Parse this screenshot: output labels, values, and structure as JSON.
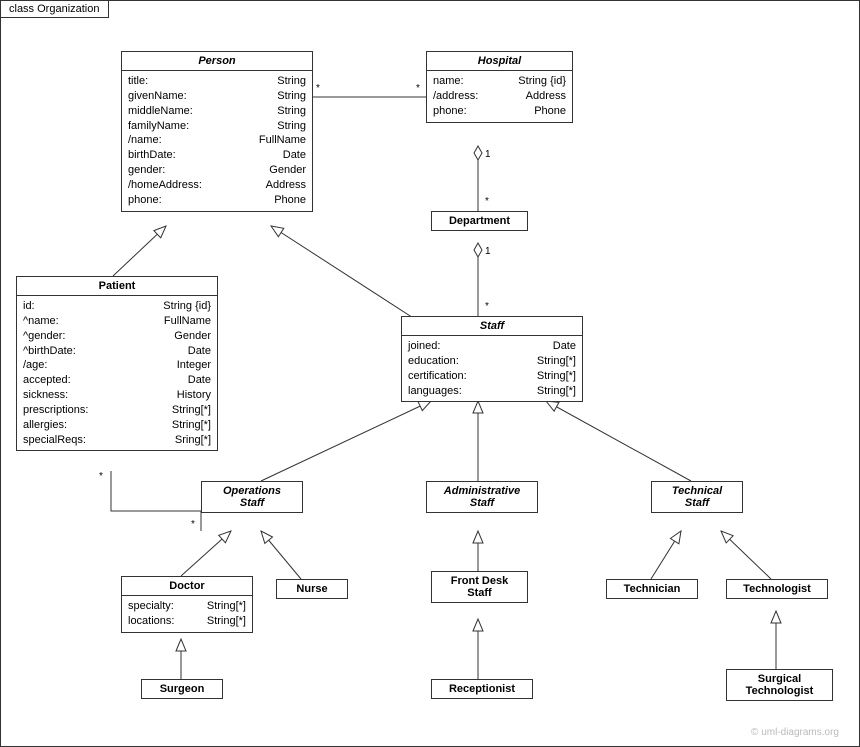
{
  "frame_label": "class Organization",
  "copyright": "© uml-diagrams.org",
  "classes": {
    "person": {
      "title": "Person",
      "attrs": [
        [
          "title:",
          "String"
        ],
        [
          "givenName:",
          "String"
        ],
        [
          "middleName:",
          "String"
        ],
        [
          "familyName:",
          "String"
        ],
        [
          "/name:",
          "FullName"
        ],
        [
          "birthDate:",
          "Date"
        ],
        [
          "gender:",
          "Gender"
        ],
        [
          "/homeAddress:",
          "Address"
        ],
        [
          "phone:",
          "Phone"
        ]
      ]
    },
    "hospital": {
      "title": "Hospital",
      "attrs": [
        [
          "name:",
          "String {id}"
        ],
        [
          "/address:",
          "Address"
        ],
        [
          "phone:",
          "Phone"
        ]
      ]
    },
    "department": {
      "title": "Department"
    },
    "patient": {
      "title": "Patient",
      "attrs": [
        [
          "id:",
          "String {id}"
        ],
        [
          "^name:",
          "FullName"
        ],
        [
          "^gender:",
          "Gender"
        ],
        [
          "^birthDate:",
          "Date"
        ],
        [
          "/age:",
          "Integer"
        ],
        [
          "accepted:",
          "Date"
        ],
        [
          "sickness:",
          "History"
        ],
        [
          "prescriptions:",
          "String[*]"
        ],
        [
          "allergies:",
          "String[*]"
        ],
        [
          "specialReqs:",
          "Sring[*]"
        ]
      ]
    },
    "staff": {
      "title": "Staff",
      "attrs": [
        [
          "joined:",
          "Date"
        ],
        [
          "education:",
          "String[*]"
        ],
        [
          "certification:",
          "String[*]"
        ],
        [
          "languages:",
          "String[*]"
        ]
      ]
    },
    "ops_staff": {
      "title": "Operations\nStaff"
    },
    "admin_staff": {
      "title": "Administrative\nStaff"
    },
    "tech_staff": {
      "title": "Technical\nStaff"
    },
    "doctor": {
      "title": "Doctor",
      "attrs": [
        [
          "specialty:",
          "String[*]"
        ],
        [
          "locations:",
          "String[*]"
        ]
      ]
    },
    "nurse": {
      "title": "Nurse"
    },
    "frontdesk": {
      "title": "Front Desk\nStaff"
    },
    "technician": {
      "title": "Technician"
    },
    "technologist": {
      "title": "Technologist"
    },
    "surgeon": {
      "title": "Surgeon"
    },
    "receptionist": {
      "title": "Receptionist"
    },
    "surg_tech": {
      "title": "Surgical\nTechnologist"
    }
  },
  "mults": {
    "m1": "*",
    "m2": "1",
    "m3": "*",
    "m4": "1",
    "m5": "*",
    "m6": "*",
    "m7": "*"
  }
}
